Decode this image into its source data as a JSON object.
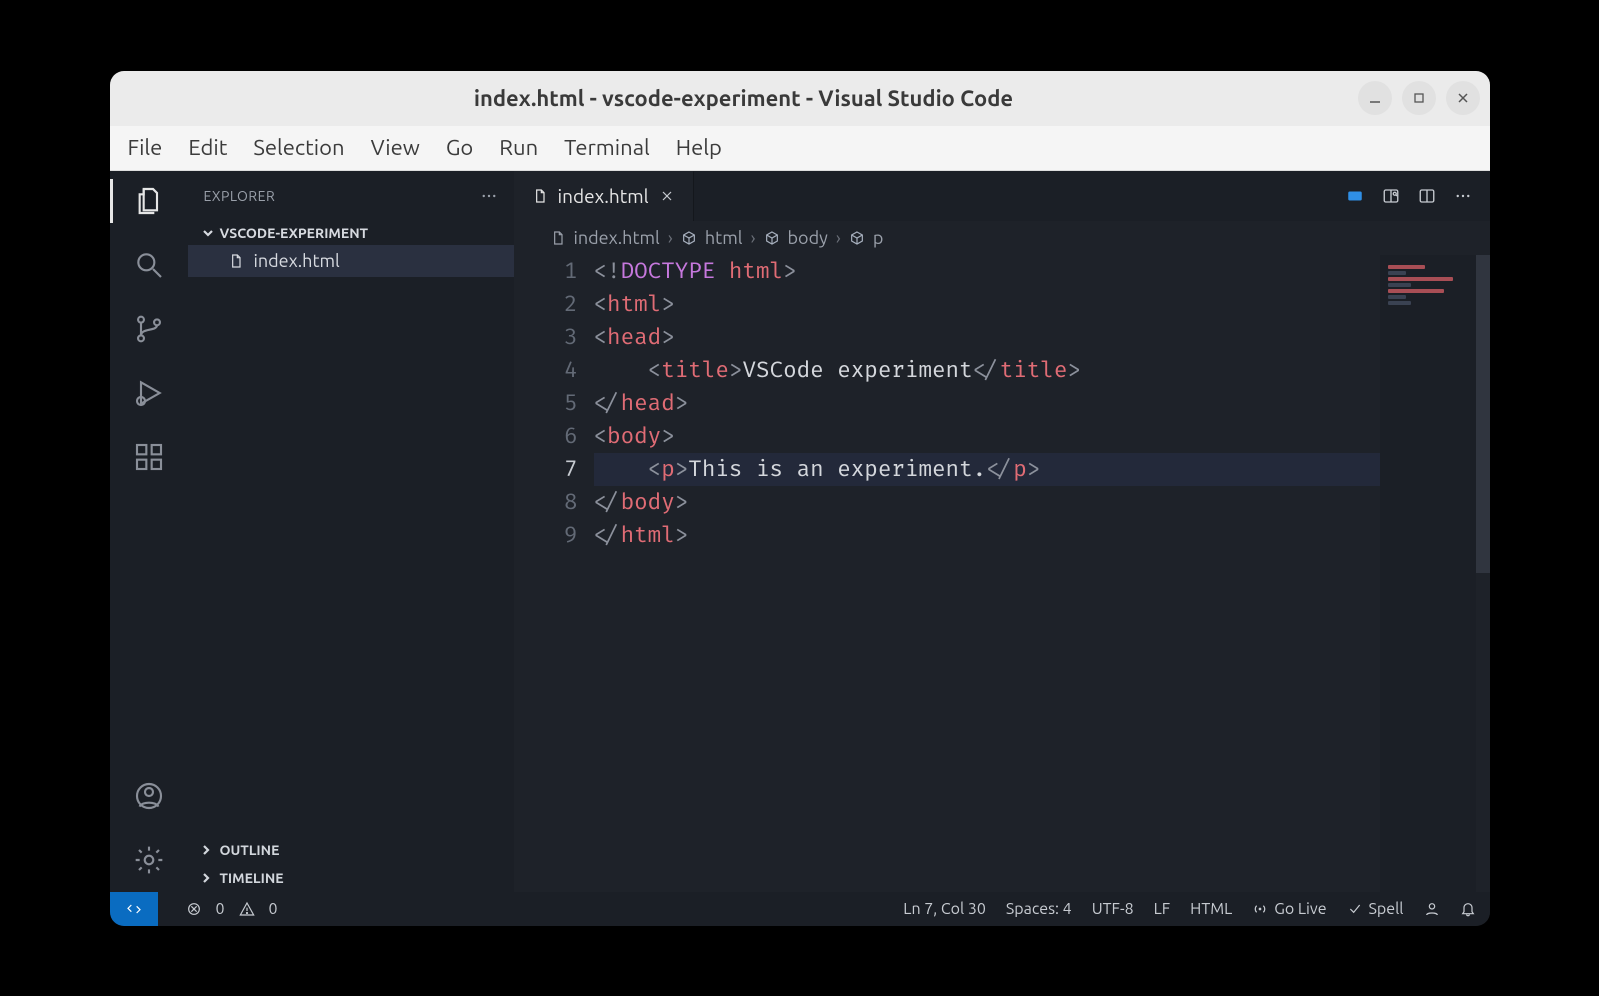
{
  "window": {
    "title": "index.html - vscode-experiment - Visual Studio Code"
  },
  "menu": [
    "File",
    "Edit",
    "Selection",
    "View",
    "Go",
    "Run",
    "Terminal",
    "Help"
  ],
  "explorer": {
    "title": "EXPLORER",
    "folder": "VSCODE-EXPERIMENT",
    "file": "index.html",
    "outline": "OUTLINE",
    "timeline": "TIMELINE"
  },
  "tab": {
    "label": "index.html"
  },
  "breadcrumb": {
    "file": "index.html",
    "parts": [
      "html",
      "body",
      "p"
    ]
  },
  "code": {
    "lines": [
      [
        [
          "br",
          "<!"
        ],
        [
          "kw",
          "DOCTYPE "
        ],
        [
          "tag",
          "html"
        ],
        [
          "br",
          ">"
        ]
      ],
      [
        [
          "br",
          "<"
        ],
        [
          "tag",
          "html"
        ],
        [
          "br",
          ">"
        ]
      ],
      [
        [
          "br",
          "<"
        ],
        [
          "tag",
          "head"
        ],
        [
          "br",
          ">"
        ]
      ],
      [
        [
          "txt",
          "    "
        ],
        [
          "br",
          "<"
        ],
        [
          "tag",
          "title"
        ],
        [
          "br",
          ">"
        ],
        [
          "txt",
          "VSCode experiment"
        ],
        [
          "br",
          "</"
        ],
        [
          "tag",
          "title"
        ],
        [
          "br",
          ">"
        ]
      ],
      [
        [
          "br",
          "</"
        ],
        [
          "tag",
          "head"
        ],
        [
          "br",
          ">"
        ]
      ],
      [
        [
          "br",
          "<"
        ],
        [
          "tag",
          "body"
        ],
        [
          "br",
          ">"
        ]
      ],
      [
        [
          "txt",
          "    "
        ],
        [
          "br",
          "<"
        ],
        [
          "tag",
          "p"
        ],
        [
          "br",
          ">"
        ],
        [
          "txt",
          "This is an experiment."
        ],
        [
          "br",
          "</"
        ],
        [
          "tag",
          "p"
        ],
        [
          "br",
          ">"
        ]
      ],
      [
        [
          "br",
          "</"
        ],
        [
          "tag",
          "body"
        ],
        [
          "br",
          ">"
        ]
      ],
      [
        [
          "br",
          "</"
        ],
        [
          "tag",
          "html"
        ],
        [
          "br",
          ">"
        ]
      ]
    ],
    "highlight_line": 7
  },
  "status": {
    "errors": "0",
    "warnings": "0",
    "cursor": "Ln 7, Col 30",
    "spaces": "Spaces: 4",
    "encoding": "UTF-8",
    "eol": "LF",
    "lang": "HTML",
    "golive": "Go Live",
    "spell": "Spell"
  }
}
